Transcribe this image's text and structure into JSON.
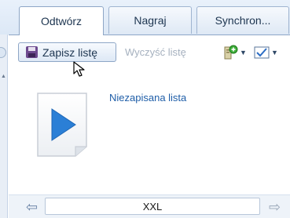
{
  "tabs": [
    {
      "label": "Odtwórz",
      "active": true
    },
    {
      "label": "Nagraj",
      "active": false
    },
    {
      "label": "Synchron...",
      "active": false
    }
  ],
  "toolbar": {
    "save_label": "Zapisz listę",
    "clear_label": "Wyczyść listę",
    "list_options_icon": "list-options-icon",
    "view_options_icon": "view-options-icon"
  },
  "playlist": {
    "title": "Niezapisana lista"
  },
  "bottom": {
    "size_value": "XXL"
  },
  "colors": {
    "accent": "#1f5ea8",
    "play_blue": "#2b7fd6",
    "tab_border": "#8ea6c6"
  }
}
